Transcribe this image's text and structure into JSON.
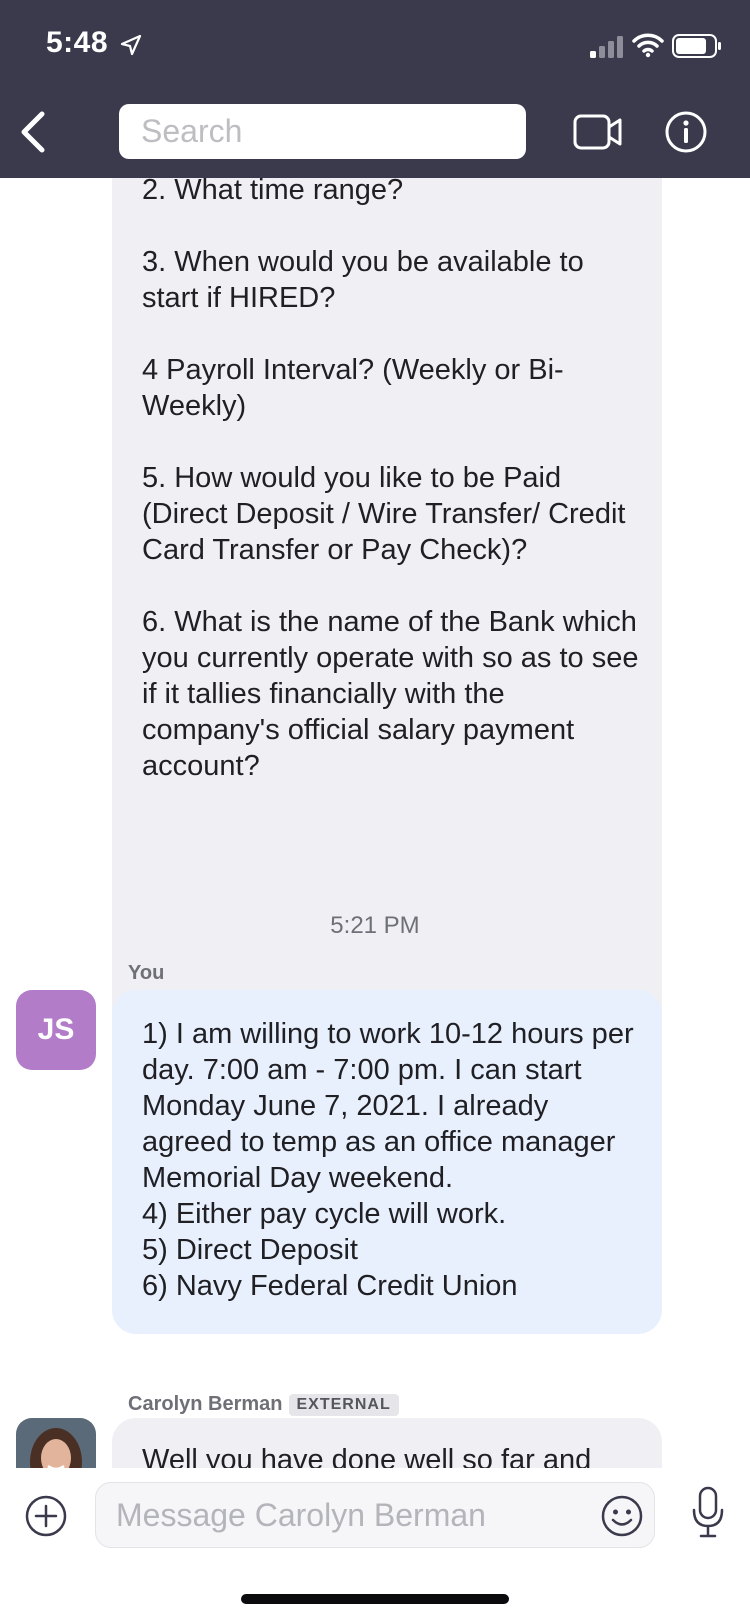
{
  "status_bar": {
    "time": "5:48",
    "icons": [
      "location-arrow-icon",
      "signal-icon",
      "wifi-icon",
      "battery-icon"
    ]
  },
  "header": {
    "back_icon": "chevron-left-icon",
    "search_placeholder": "Search",
    "video_icon": "video-camera-icon",
    "info_icon": "info-icon"
  },
  "messages": [
    {
      "direction": "incoming",
      "text": "2. What time range?\n\n3. When would you be available to start if HIRED?\n\n4 Payroll Interval? (Weekly or Bi-Weekly)\n\n5. How would you like to be Paid (Direct Deposit / Wire Transfer/ Credit Card Transfer or Pay Check)?\n\n6. What is the name of the Bank which you currently operate with so as to see if it tallies financially with the company's official salary payment account?"
    },
    {
      "timestamp": "5:21 PM",
      "sender": "You",
      "avatar_initials": "JS",
      "direction": "outgoing",
      "text": "1) I am willing to work 10-12 hours per day. 7:00 am - 7:00 pm. I can start Monday June 7, 2021. I already agreed to temp as an office manager Memorial Day weekend.\n4) Either pay cycle will work.\n5) Direct Deposit\n6) Navy Federal Credit Union"
    },
    {
      "sender": "Carolyn Berman",
      "badge": "EXTERNAL",
      "direction": "incoming",
      "text": "Well you have done well so far and"
    }
  ],
  "composer": {
    "placeholder": "Message Carolyn Berman",
    "icons": [
      "add-circle-icon",
      "emoji-icon",
      "microphone-icon"
    ]
  },
  "colors": {
    "header_bg": "#3b3a4d",
    "incoming_bubble": "#efeff4",
    "outgoing_bubble": "#e7f0fc",
    "avatar_js": "#b27cc9"
  }
}
